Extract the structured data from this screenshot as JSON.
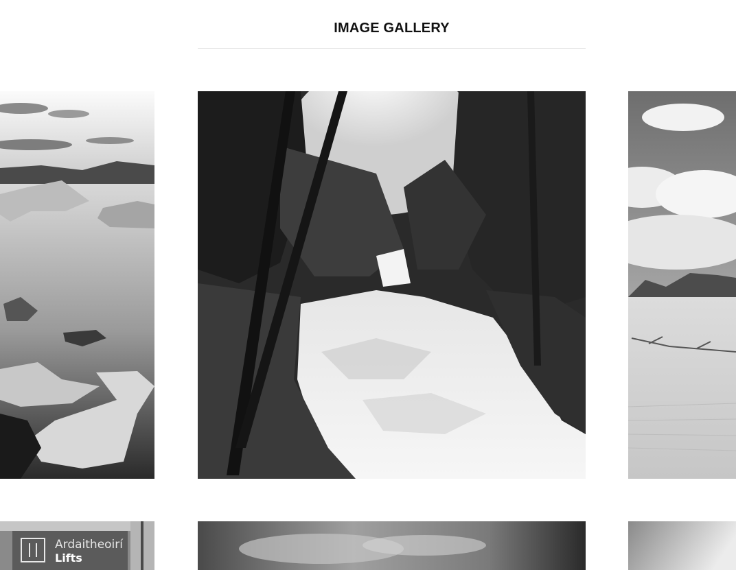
{
  "header": {
    "title": "IMAGE GALLERY"
  },
  "gallery": {
    "images": [
      {
        "id": "ice",
        "subject": "icebergs on a lagoon"
      },
      {
        "id": "waterfall",
        "subject": "forest waterfall"
      },
      {
        "id": "desert",
        "subject": "sand dunes with clouds"
      },
      {
        "id": "lifts",
        "subject": "lift sign",
        "sign_line_1": "Ardaitheoirí",
        "sign_line_2": "Lifts"
      },
      {
        "id": "sky",
        "subject": "cloudy sky"
      },
      {
        "id": "fade",
        "subject": "grey gradient"
      }
    ]
  },
  "colors": {
    "background": "#ffffff",
    "title": "#111111",
    "divider": "#e5e5e5"
  }
}
